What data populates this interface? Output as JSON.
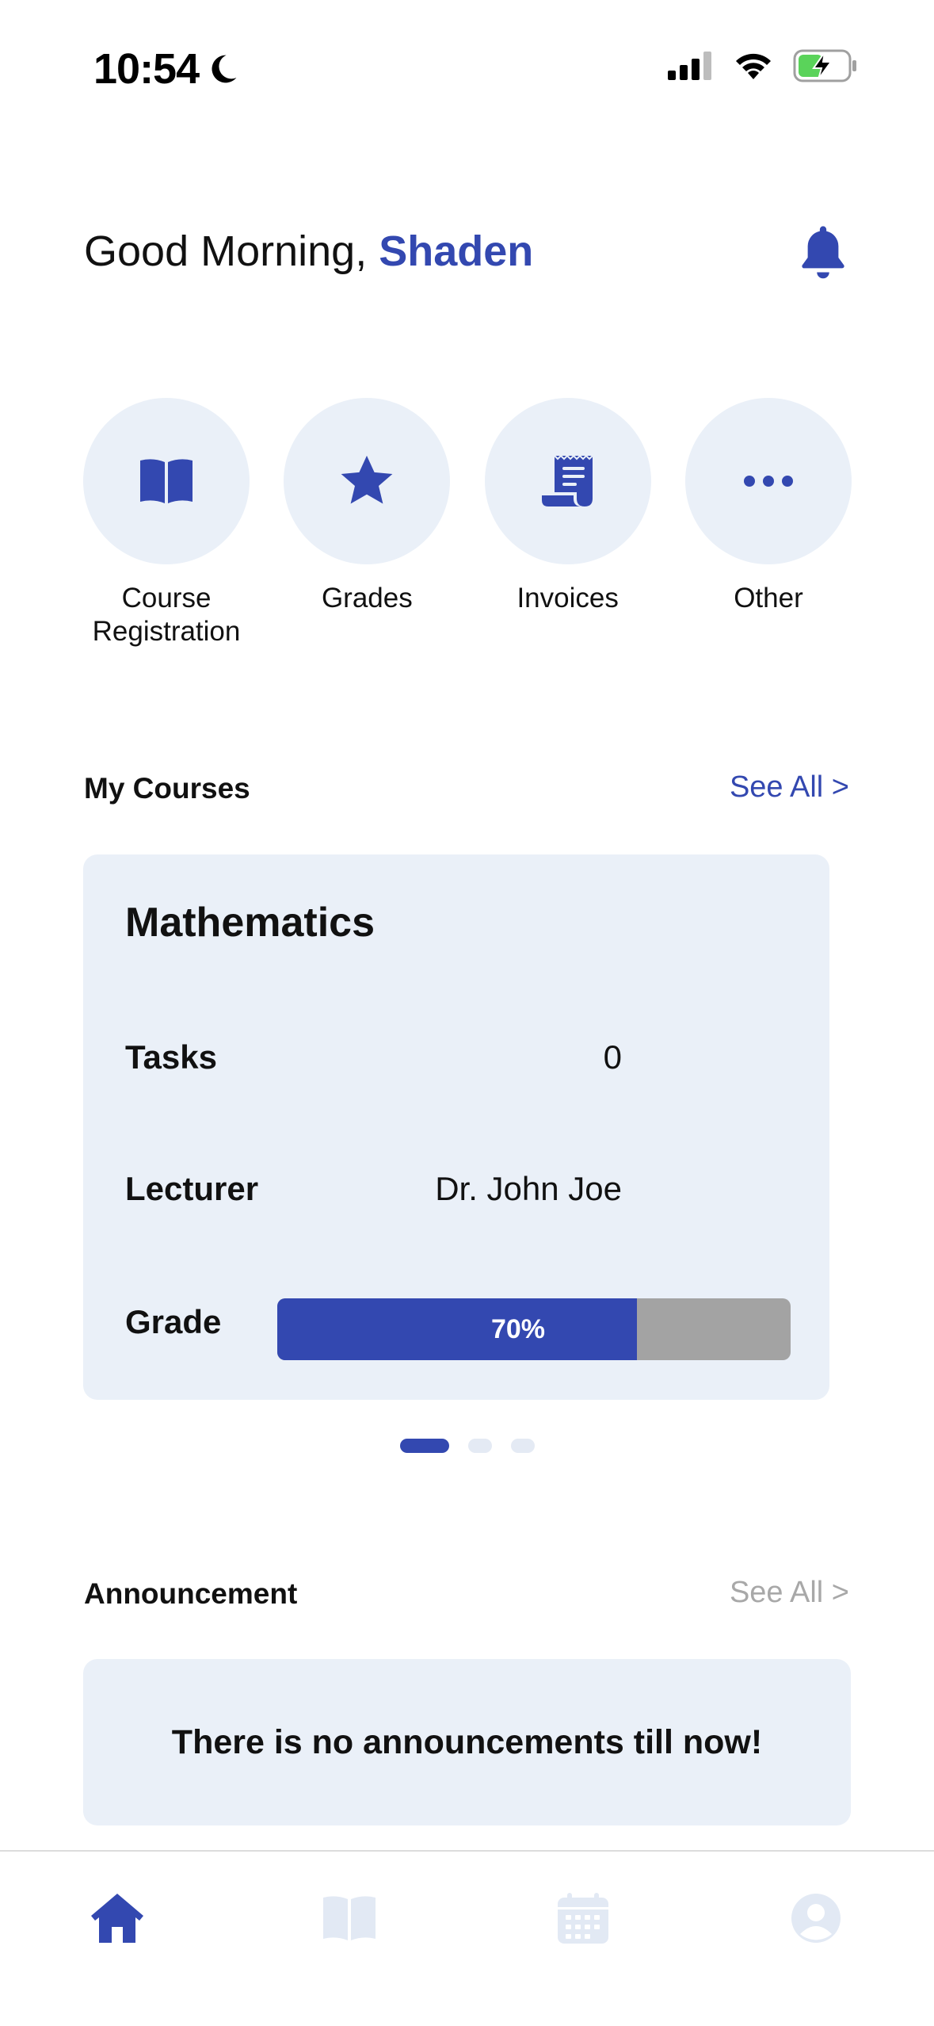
{
  "status_bar": {
    "time": "10:54"
  },
  "header": {
    "greeting_prefix": "Good Morning, ",
    "user_name": "Shaden"
  },
  "quick_actions": [
    {
      "label": "Course\nRegistration",
      "icon": "book-icon"
    },
    {
      "label": "Grades",
      "icon": "star-icon"
    },
    {
      "label": "Invoices",
      "icon": "receipt-icon"
    },
    {
      "label": "Other",
      "icon": "more-icon"
    }
  ],
  "my_courses": {
    "title": "My Courses",
    "see_all": "See All >",
    "course": {
      "name": "Mathematics",
      "tasks_label": "Tasks",
      "tasks_value": "0",
      "lecturer_label": "Lecturer",
      "lecturer_value": "Dr. John Joe",
      "grade_label": "Grade",
      "grade_text": "70%",
      "grade_fraction": 0.7
    },
    "pager_count": 3,
    "pager_active": 0
  },
  "announcements": {
    "title": "Announcement",
    "see_all": "See All >",
    "empty_text": "There is no announcements till now!"
  },
  "colors": {
    "accent": "#3348B0",
    "card_bg": "#EAF0F8",
    "inactive_icon": "#E2E9F4",
    "progress_track": "#A3A3A3"
  },
  "tab_bar": [
    "home-icon",
    "book-icon",
    "calendar-icon",
    "profile-icon"
  ]
}
